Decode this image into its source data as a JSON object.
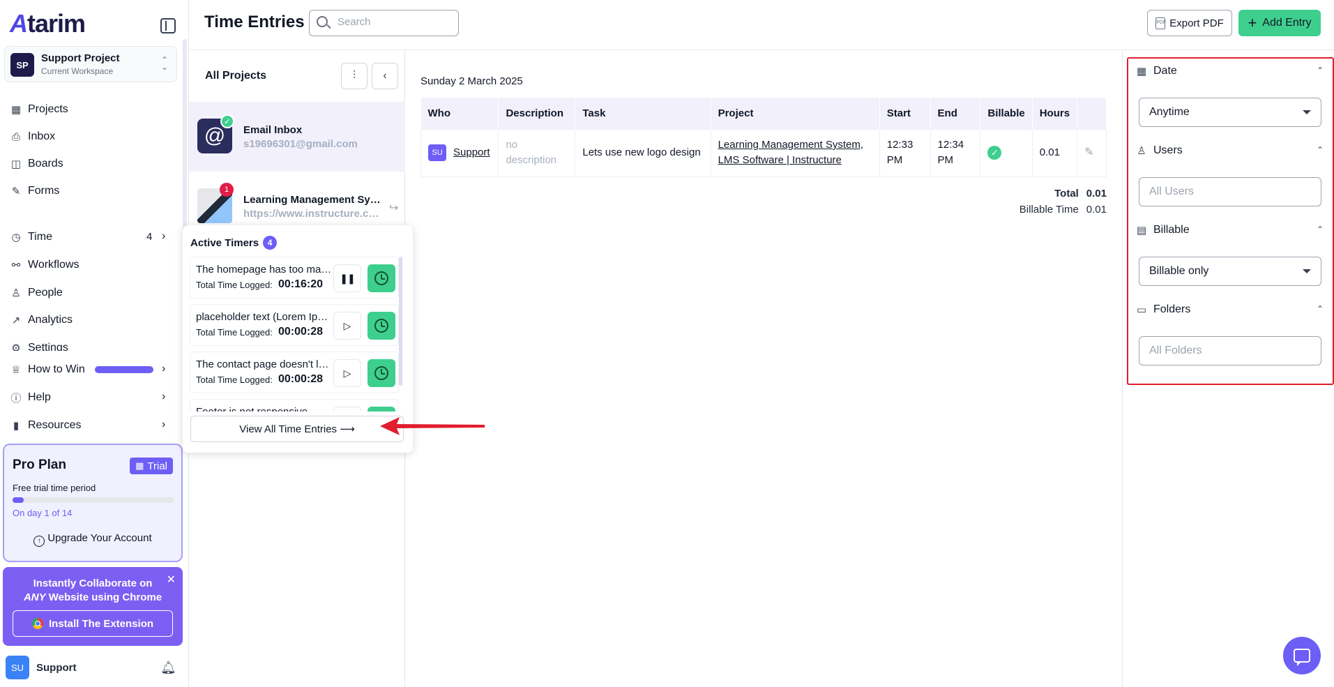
{
  "app": {
    "logo": "Atarim"
  },
  "workspace": {
    "initials": "SP",
    "name": "Support Project",
    "subtitle": "Current Workspace"
  },
  "nav": {
    "projects": "Projects",
    "inbox": "Inbox",
    "boards": "Boards",
    "forms": "Forms",
    "time": "Time",
    "time_count": "4",
    "workflows": "Workflows",
    "people": "People",
    "analytics": "Analytics",
    "settings": "Settings",
    "how_to_win": "How to Win",
    "help": "Help",
    "resources": "Resources"
  },
  "plan": {
    "title": "Pro Plan",
    "badge": "Trial",
    "subtitle": "Free trial time period",
    "day_label": "On day 1 of 14",
    "progress": 0.07,
    "upgrade": "Upgrade Your Account"
  },
  "extension": {
    "line1": "Instantly Collaborate on",
    "line2_em": "ANY",
    "line2_rest": " Website using Chrome",
    "button": "Install The Extension"
  },
  "user": {
    "initials": "SU",
    "name": "Support"
  },
  "header": {
    "title": "Time Entries",
    "search_placeholder": "Search",
    "export": "Export PDF",
    "add": "Add Entry"
  },
  "projects": {
    "heading": "All Projects",
    "items": [
      {
        "name": "Email Inbox",
        "sub": "s19696301@gmail.com"
      },
      {
        "name": "Learning Management System, LMS Software | Instructure",
        "sub": "https://www.instructure.com",
        "badge": "1"
      }
    ]
  },
  "timers": {
    "title": "Active Timers",
    "count": "4",
    "logged_label": "Total Time Logged:",
    "items": [
      {
        "name": "The homepage has too many elements",
        "time": "00:16:20",
        "state": "pause"
      },
      {
        "name": "placeholder text (Lorem Ipsum)",
        "time": "00:00:28",
        "state": "play"
      },
      {
        "name": "The contact page doesn't load",
        "time": "00:00:28",
        "state": "play"
      },
      {
        "name": "Footer is not responsive",
        "time": "",
        "state": "play"
      }
    ],
    "view_all": "View All Time Entries ⟶"
  },
  "entries": {
    "date": "Sunday 2 March 2025",
    "columns": [
      "Who",
      "Description",
      "Task",
      "Project",
      "Start",
      "End",
      "Billable",
      "Hours"
    ],
    "rows": [
      {
        "who_initials": "SU",
        "who": "Support",
        "description": "no description",
        "task": "Lets use new logo design",
        "project": "Learning Management System, LMS Software | Instructure",
        "start": "12:33 PM",
        "end": "12:34 PM",
        "hours": "0.01"
      }
    ],
    "total_label": "Total",
    "total_value": "0.01",
    "billable_label": "Billable Time",
    "billable_value": "0.01"
  },
  "filters": {
    "date_label": "Date",
    "date_value": "Anytime",
    "users_label": "Users",
    "users_placeholder": "All Users",
    "billable_label": "Billable",
    "billable_value": "Billable only",
    "folders_label": "Folders",
    "folders_placeholder": "All Folders"
  },
  "colors": {
    "accent": "#6d5ef5",
    "green": "#3ecf8e",
    "highlight": "#e11d2e"
  }
}
